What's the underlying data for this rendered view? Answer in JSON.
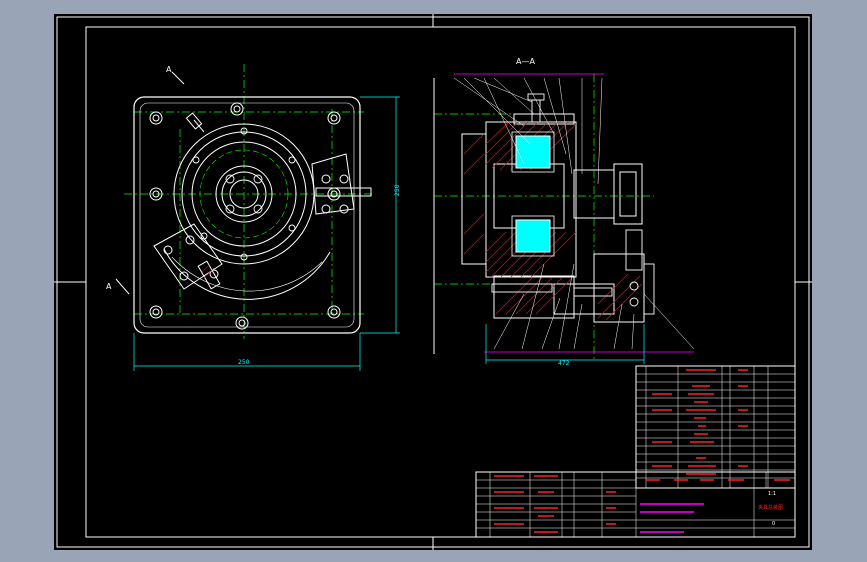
{
  "drawing": {
    "section_label": "A—A",
    "section_mark_top": "A",
    "section_mark_bottom": "A",
    "dim_plan_width": "250",
    "dim_plan_height": "250",
    "dim_section_width": "472",
    "drawing_title": "夹具总装图",
    "scale": "1:1",
    "sheet_no": "0"
  },
  "colors": {
    "background": "#000000",
    "frame": "#ffffff",
    "outline": "#ffffff",
    "centerline": "#00ff00",
    "dimension": "#00ffff",
    "hatch": "#ff0000",
    "coil": "#00ffff",
    "table_text": "#ff2020",
    "highlight": "#ff00ff"
  }
}
